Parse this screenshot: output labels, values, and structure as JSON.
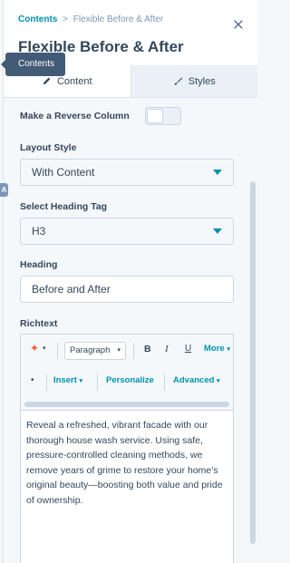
{
  "breadcrumb": {
    "root": "Contents",
    "separator": ">",
    "current": "Flexible Before & After"
  },
  "title": "Flexible Before & After",
  "tooltip": "Contents",
  "edge_badge": "A",
  "tabs": [
    {
      "label": "Content",
      "icon": "pencil-icon",
      "active": true
    },
    {
      "label": "Styles",
      "icon": "brush-icon",
      "active": false
    }
  ],
  "fields": {
    "reverse_column": {
      "label": "Make a Reverse Column",
      "on": false
    },
    "layout_style": {
      "label": "Layout Style",
      "value": "With Content"
    },
    "heading_tag": {
      "label": "Select Heading Tag",
      "value": "H3"
    },
    "heading": {
      "label": "Heading",
      "value": "Before and After"
    },
    "richtext": {
      "label": "Richtext",
      "toolbar": {
        "format_select": "Paragraph",
        "bold": "B",
        "italic": "I",
        "underline": "U",
        "more": "More",
        "insert": "Insert",
        "personalize": "Personalize",
        "advanced": "Advanced"
      },
      "body": "Reveal a refreshed, vibrant facade with our thorough house wash service. Using safe, pressure-controlled cleaning methods, we remove years of grime to restore your home’s original beauty—boosting both value and pride of ownership."
    }
  },
  "colors": {
    "accent": "#0091ae",
    "text": "#33475b",
    "border": "#cbd6e2",
    "sprocket": "#ff5c35",
    "tooltip": "#425b76"
  }
}
